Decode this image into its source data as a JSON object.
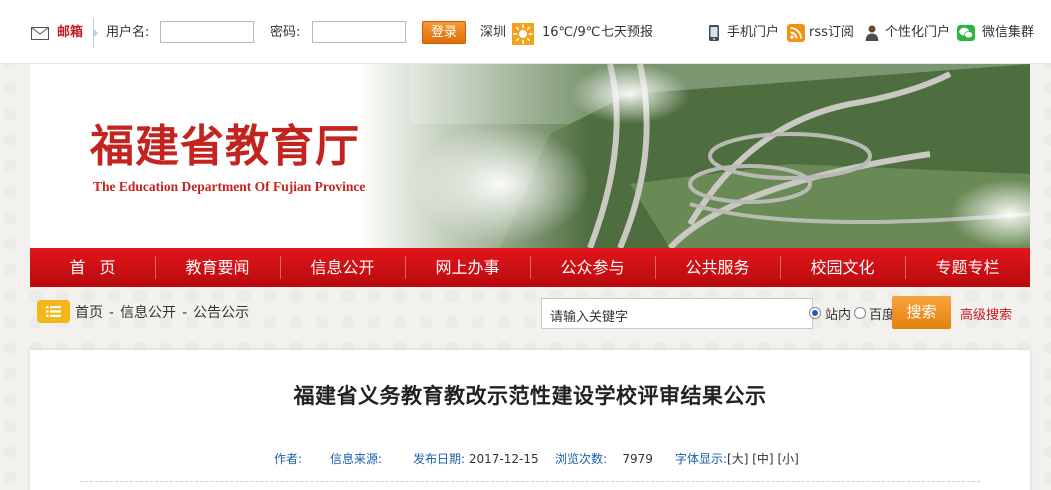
{
  "topbar": {
    "mail_label": "邮箱",
    "username_label": "用户名:",
    "username_value": "",
    "password_label": "密码:",
    "password_value": "",
    "login_button": "登录",
    "weather": {
      "city": "深圳",
      "temperature": "16℃/9℃",
      "forecast_link": "七天预报"
    },
    "quick_links": [
      {
        "label": "手机门户",
        "icon": "mobile-icon"
      },
      {
        "label": "rss订阅",
        "icon": "rss-icon"
      },
      {
        "label": "个性化门户",
        "icon": "person-icon"
      },
      {
        "label": "微信集群",
        "icon": "wechat-icon"
      }
    ]
  },
  "banner": {
    "title": "福建省教育厅",
    "subtitle": "The Education Department Of Fujian Province"
  },
  "nav": {
    "items": [
      "首页",
      "教育要闻",
      "信息公开",
      "网上办事",
      "公众参与",
      "公共服务",
      "校园文化",
      "专题专栏"
    ]
  },
  "breadcrumb": {
    "items": [
      "首页",
      "信息公开",
      "公告公示"
    ],
    "separator": "-"
  },
  "search": {
    "placeholder": "请输入关键字",
    "scope_options": [
      "站内",
      "百度"
    ],
    "selected_scope": "站内",
    "button": "搜索",
    "advanced_link": "高级搜索"
  },
  "article": {
    "title": "福建省义务教育教改示范性建设学校评审结果公示",
    "meta": {
      "author_label": "作者:",
      "author": "",
      "source_label": "信息来源:",
      "source": "",
      "date_label": "发布日期:",
      "date": "2017-12-15",
      "views_label": "浏览次数:",
      "views": "7979",
      "font_label": "字体显示:",
      "font_large": "[大]",
      "font_medium": "[中]",
      "font_small": "[小]"
    }
  },
  "colors": {
    "brand_red": "#c4241f",
    "nav_red": "#d3111a",
    "accent_orange": "#ec8a1c",
    "link_blue": "#1e5fa8"
  }
}
